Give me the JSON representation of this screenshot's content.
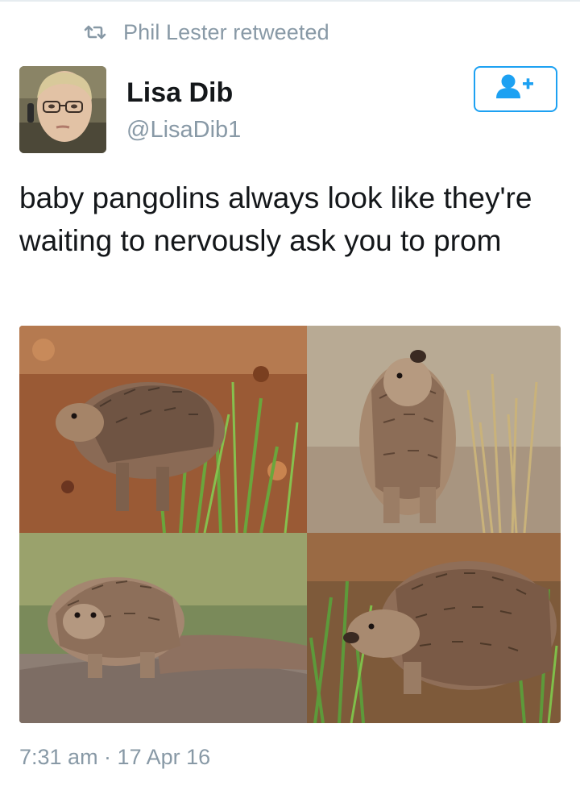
{
  "retweet": {
    "label": "Phil Lester retweeted",
    "icon": "retweet-icon"
  },
  "author": {
    "name": "Lisa Dib",
    "handle": "@LisaDib1",
    "avatar": "avatar-photo"
  },
  "follow_button": {
    "icon": "follow-user-plus-icon"
  },
  "tweet": {
    "text": "baby pangolins always look like they're waiting to nervously ask you to prom",
    "media": [
      {
        "name": "media-photo-1",
        "description": "pangolin-red-soil-grass"
      },
      {
        "name": "media-photo-2",
        "description": "pangolin-holding-grass"
      },
      {
        "name": "media-photo-3",
        "description": "pangolin-on-rock"
      },
      {
        "name": "media-photo-4",
        "description": "pangolin-in-grass"
      }
    ],
    "timestamp": "7:31 am · 17 Apr 16"
  },
  "colors": {
    "accent": "#1da1f2",
    "muted": "#8899a6",
    "text": "#14171a"
  }
}
